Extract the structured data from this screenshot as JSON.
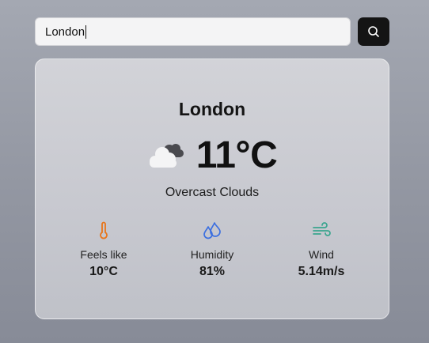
{
  "search": {
    "value": "London"
  },
  "weather": {
    "city": "London",
    "temperature": "11°C",
    "condition": "Overcast Clouds",
    "icon": "overcast-clouds-icon"
  },
  "stats": [
    {
      "label": "Feels like",
      "value": "10°C",
      "icon": "thermometer-icon",
      "color": "#e8751a"
    },
    {
      "label": "Humidity",
      "value": "81%",
      "icon": "droplets-icon",
      "color": "#3b6fe0"
    },
    {
      "label": "Wind",
      "value": "5.14m/s",
      "icon": "wind-icon",
      "color": "#3aa58f"
    }
  ],
  "colors": {
    "search_button": "#141414"
  }
}
